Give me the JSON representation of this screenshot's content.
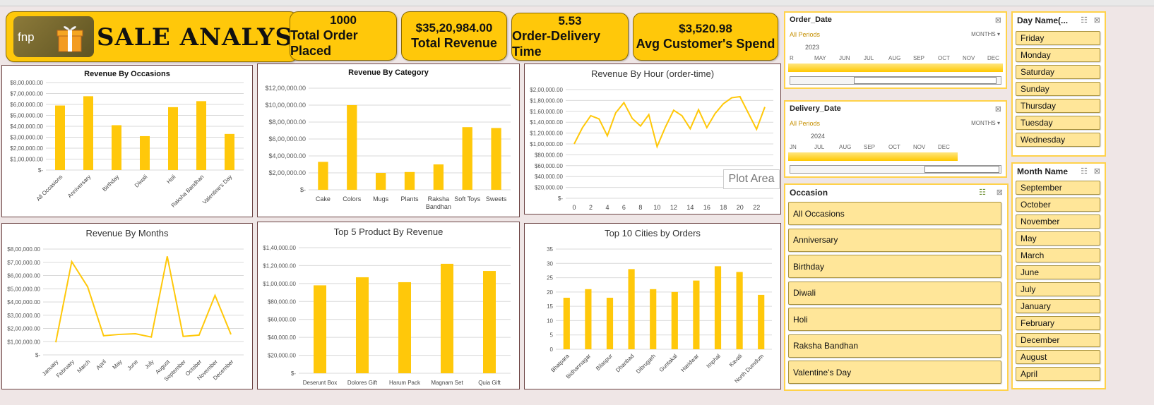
{
  "header": {
    "title": "SALE ANALYSIS",
    "logo_text": "fnp"
  },
  "kpis": [
    {
      "value": "1000",
      "label": "Total Order Placed"
    },
    {
      "value": "$35,20,984.00",
      "label": "Total Revenue"
    },
    {
      "value": "5.53",
      "label": "Order-Delivery Time"
    },
    {
      "value": "$3,520.98",
      "label": "Avg Customer's Spend"
    }
  ],
  "colors": {
    "accent": "#FFC80A",
    "slicer_item": "#FFE699",
    "line": "#FFC80A"
  },
  "charts": {
    "occasions": {
      "title": "Revenue By Occasions",
      "type": "bar",
      "categories": [
        "All Occasions",
        "Anniversary",
        "Birthday",
        "Diwali",
        "Holi",
        "Raksha Bandhan",
        "Valentine's Day"
      ],
      "values": [
        590000,
        675000,
        410000,
        310000,
        575000,
        630000,
        330000
      ],
      "ylim": [
        0,
        800000
      ],
      "yticks": [
        "$-",
        "$1,00,000.00",
        "$2,00,000.00",
        "$3,00,000.00",
        "$4,00,000.00",
        "$5,00,000.00",
        "$6,00,000.00",
        "$7,00,000.00",
        "$8,00,000.00"
      ]
    },
    "category": {
      "title": "Revenue By Category",
      "type": "bar",
      "categories": [
        "Cake",
        "Colors",
        "Mugs",
        "Plants",
        "Raksha Bandhan",
        "Soft Toys",
        "Sweets"
      ],
      "values": [
        330000,
        1000000,
        200000,
        210000,
        300000,
        740000,
        730000
      ],
      "ylim": [
        0,
        1200000
      ],
      "yticks": [
        "$-",
        "$2,00,000.00",
        "$4,00,000.00",
        "$6,00,000.00",
        "$8,00,000.00",
        "$10,00,000.00",
        "$12,00,000.00"
      ]
    },
    "hour": {
      "title": "Revenue By Hour (order-time)",
      "type": "line",
      "x": [
        0,
        1,
        2,
        3,
        4,
        5,
        6,
        7,
        8,
        9,
        10,
        11,
        12,
        13,
        14,
        15,
        16,
        17,
        18,
        19,
        20,
        21,
        22,
        23
      ],
      "xticks": [
        "0",
        "2",
        "4",
        "6",
        "8",
        "10",
        "12",
        "14",
        "16",
        "18",
        "20",
        "22"
      ],
      "values": [
        100000,
        130000,
        152000,
        146000,
        115000,
        157000,
        176000,
        147000,
        133000,
        154000,
        95000,
        131000,
        162000,
        152000,
        128000,
        163000,
        130000,
        156000,
        174000,
        185000,
        187000,
        157000,
        127000,
        168000
      ],
      "ylim": [
        0,
        200000
      ],
      "yticks": [
        "$-",
        "$20,000.00",
        "$40,000.00",
        "$60,000.00",
        "$80,000.00",
        "$1,00,000.00",
        "$1,20,000.00",
        "$1,40,000.00",
        "$1,60,000.00",
        "$1,80,000.00",
        "$2,00,000.00"
      ]
    },
    "months": {
      "title": "Revenue By Months",
      "type": "line",
      "categories": [
        "January",
        "February",
        "March",
        "April",
        "May",
        "June",
        "July",
        "August",
        "September",
        "October",
        "November",
        "December"
      ],
      "values": [
        95000,
        705000,
        515000,
        145000,
        155000,
        160000,
        135000,
        745000,
        140000,
        150000,
        450000,
        155000
      ],
      "ylim": [
        0,
        800000
      ],
      "yticks": [
        "$-",
        "$1,00,000.00",
        "$2,00,000.00",
        "$3,00,000.00",
        "$4,00,000.00",
        "$5,00,000.00",
        "$6,00,000.00",
        "$7,00,000.00",
        "$8,00,000.00"
      ]
    },
    "products": {
      "title": "Top 5 Product By Revenue",
      "type": "bar",
      "categories": [
        "Deserunt Box",
        "Dolores Gift",
        "Harum Pack",
        "Magnam Set",
        "Quia Gift"
      ],
      "values": [
        98000,
        107000,
        101500,
        122000,
        114000
      ],
      "ylim": [
        0,
        140000
      ],
      "yticks": [
        "$-",
        "$20,000.00",
        "$40,000.00",
        "$60,000.00",
        "$80,000.00",
        "$1,00,000.00",
        "$1,20,000.00",
        "$1,40,000.00"
      ]
    },
    "cities": {
      "title": "Top 10 Cities by Orders",
      "type": "bar",
      "categories": [
        "Bhatpara",
        "Bidhannagar",
        "Bilaspur",
        "Dhanbad",
        "Dibrugarh",
        "Guntakal",
        "Haridwar",
        "Imphal",
        "Kavali",
        "North Dumdum"
      ],
      "values": [
        18,
        21,
        18,
        28,
        21,
        20,
        24,
        29,
        27,
        19
      ],
      "ylim": [
        0,
        35
      ],
      "yticks": [
        "0",
        "5",
        "10",
        "15",
        "20",
        "25",
        "30",
        "35"
      ]
    }
  },
  "plot_area_label": "Plot Area",
  "timeline_order": {
    "title": "Order_Date",
    "periods": "All Periods",
    "level": "MONTHS",
    "year": "2023",
    "months": [
      "R",
      "MAY",
      "JUN",
      "JUL",
      "AUG",
      "SEP",
      "OCT",
      "NOV",
      "DEC"
    ]
  },
  "timeline_delivery": {
    "title": "Delivery_Date",
    "periods": "All Periods",
    "level": "MONTHS",
    "year": "2024",
    "months": [
      "JN",
      "JUL",
      "AUG",
      "SEP",
      "OCT",
      "NOV",
      "DEC"
    ]
  },
  "occasion_slicer": {
    "title": "Occasion",
    "items": [
      "All Occasions",
      "Anniversary",
      "Birthday",
      "Diwali",
      "Holi",
      "Raksha Bandhan",
      "Valentine's Day"
    ]
  },
  "day_slicer": {
    "title": "Day Name(...",
    "items": [
      "Friday",
      "Monday",
      "Saturday",
      "Sunday",
      "Thursday",
      "Tuesday",
      "Wednesday"
    ]
  },
  "month_slicer": {
    "title": "Month Name",
    "items": [
      "September",
      "October",
      "November",
      "May",
      "March",
      "June",
      "July",
      "January",
      "February",
      "December",
      "August",
      "April"
    ]
  }
}
